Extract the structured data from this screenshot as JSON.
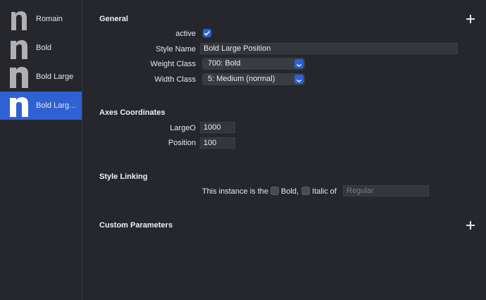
{
  "sidebar": {
    "instances": [
      {
        "label": "Romain",
        "icon": "glyph-n-icon"
      },
      {
        "label": "Bold",
        "icon": "glyph-n-icon"
      },
      {
        "label": "Bold Large",
        "icon": "glyph-n-icon"
      },
      {
        "label": "Bold Large Position",
        "icon": "glyph-n-icon",
        "selected": true
      }
    ]
  },
  "general": {
    "heading": "General",
    "active_label": "active",
    "active_checked": true,
    "style_name_label": "Style Name",
    "style_name_value": "Bold Large Position",
    "weight_class_label": "Weight Class",
    "weight_class_value": "700: Bold",
    "width_class_label": "Width Class",
    "width_class_value": "5: Medium (normal)"
  },
  "axes": {
    "heading": "Axes Coordinates",
    "large_label": "LargeO",
    "large_value": "1000",
    "position_label": "Position",
    "position_value": "100"
  },
  "linking": {
    "heading": "Style Linking",
    "sentence": "This instance is the",
    "bold_label": "Bold,",
    "italic_label": "Italic of",
    "bold_checked": false,
    "italic_checked": false,
    "linked_placeholder": "Regular"
  },
  "custom": {
    "heading": "Custom Parameters"
  },
  "colors": {
    "background": "#25272d",
    "accent": "#2f61d3"
  }
}
